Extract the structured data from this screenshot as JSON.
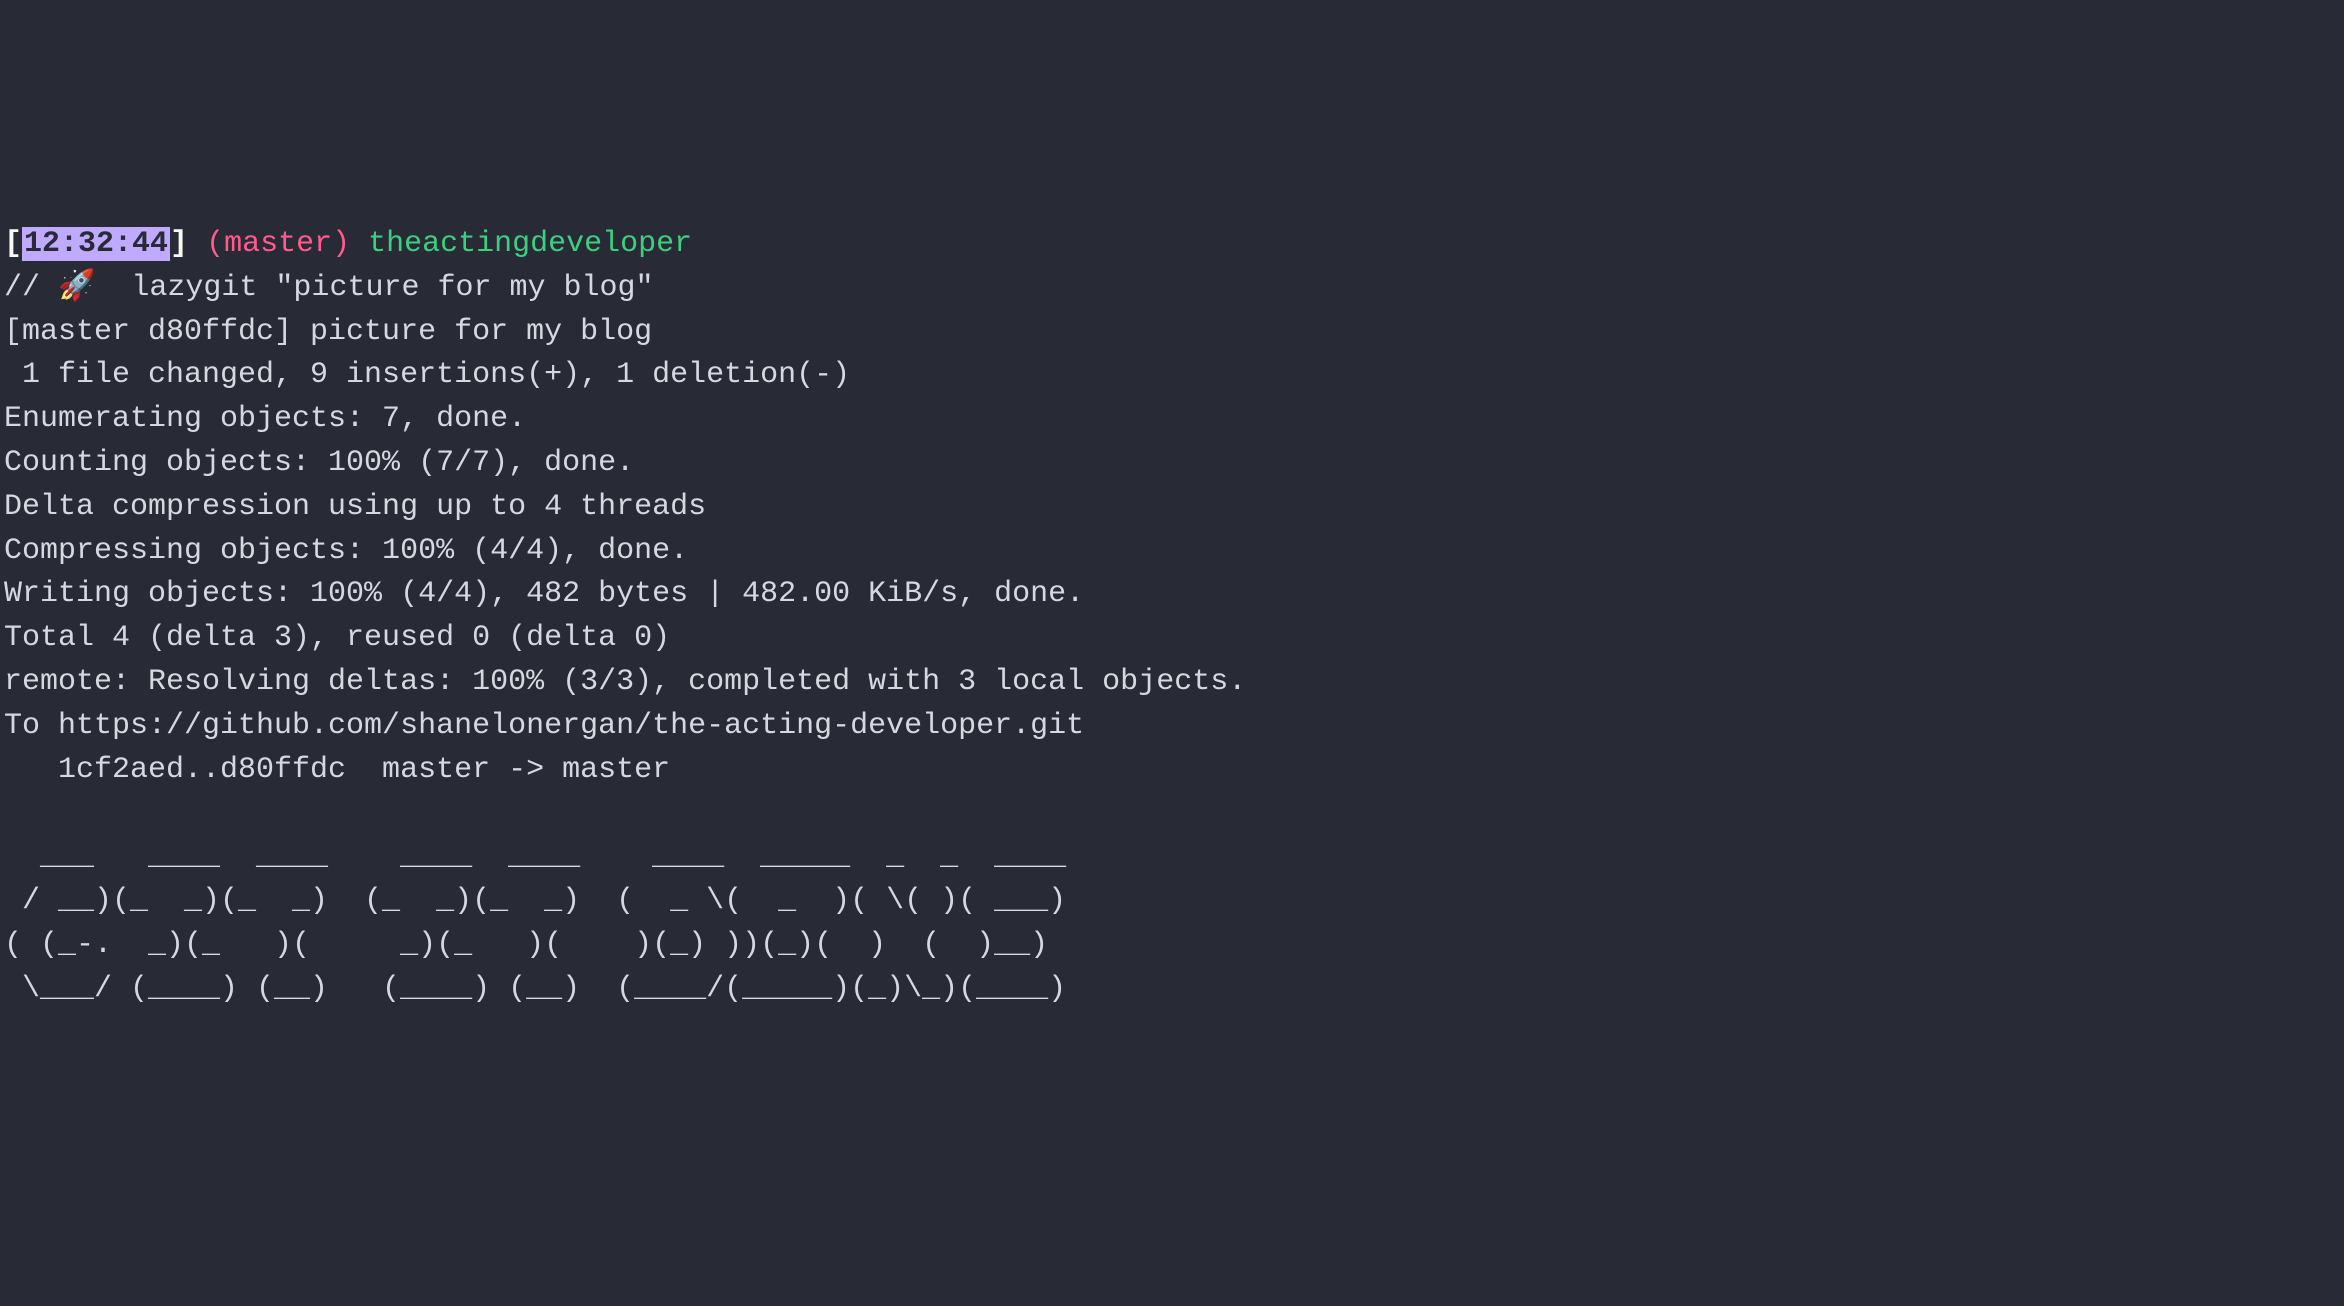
{
  "prompt": {
    "open_bracket": "[",
    "timestamp": "12:32:44",
    "close_bracket": "]",
    "branch": "(master)",
    "directory": "theactingdeveloper",
    "marker": "//",
    "rocket": "🚀",
    "command": "lazygit \"picture for my blog\""
  },
  "output": {
    "l0": "[master d80ffdc] picture for my blog",
    "l1": " 1 file changed, 9 insertions(+), 1 deletion(-)",
    "l2": "Enumerating objects: 7, done.",
    "l3": "Counting objects: 100% (7/7), done.",
    "l4": "Delta compression using up to 4 threads",
    "l5": "Compressing objects: 100% (4/4), done.",
    "l6": "Writing objects: 100% (4/4), 482 bytes | 482.00 KiB/s, done.",
    "l7": "Total 4 (delta 3), reused 0 (delta 0)",
    "l8": "remote: Resolving deltas: 100% (3/3), completed with 3 local objects.",
    "l9": "To https://github.com/shanelonergan/the-acting-developer.git",
    "l10": "   1cf2aed..d80ffdc  master -> master",
    "blank": ""
  },
  "ascii": {
    "a0": "  ___   ____  ____    ____  ____    ____  _____  _  _  ____ ",
    "a1": " / __)(_  _)(_  _)  (_  _)(_  _)  (  _ \\(  _  )( \\( )( ___)",
    "a2": "( (_-.  _)(_   )(     _)(_   )(    )(_) ))(_)(  )  (  )__) ",
    "a3": " \\___/ (____) (__)   (____) (__)  (____/(_____)(_)\\_)(____)"
  }
}
